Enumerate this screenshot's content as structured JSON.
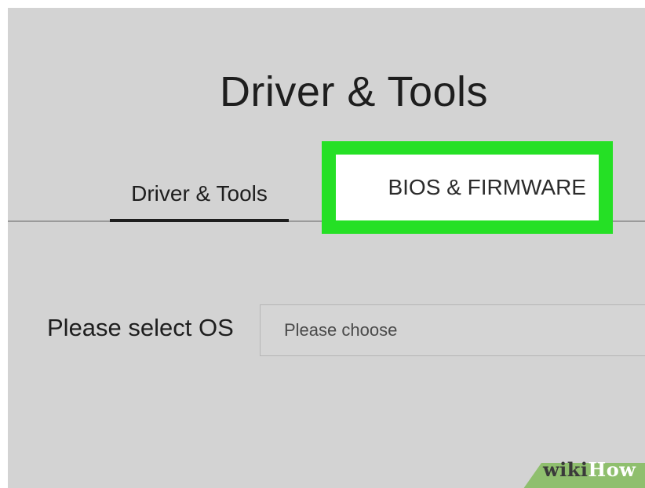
{
  "header": {
    "title": "Driver & Tools"
  },
  "tabs": [
    {
      "label": "Driver & Tools",
      "active": true
    },
    {
      "label": "BIOS & FIRMWARE",
      "active": false,
      "highlighted": true
    }
  ],
  "os_selector": {
    "label": "Please select OS",
    "placeholder": "Please choose"
  },
  "watermark": {
    "wiki": "wiki",
    "how": "How"
  },
  "colors": {
    "background": "#d3d3d3",
    "highlight": "#25e025",
    "text": "#1e1e1e",
    "watermark_green": "#8fbf6e"
  }
}
